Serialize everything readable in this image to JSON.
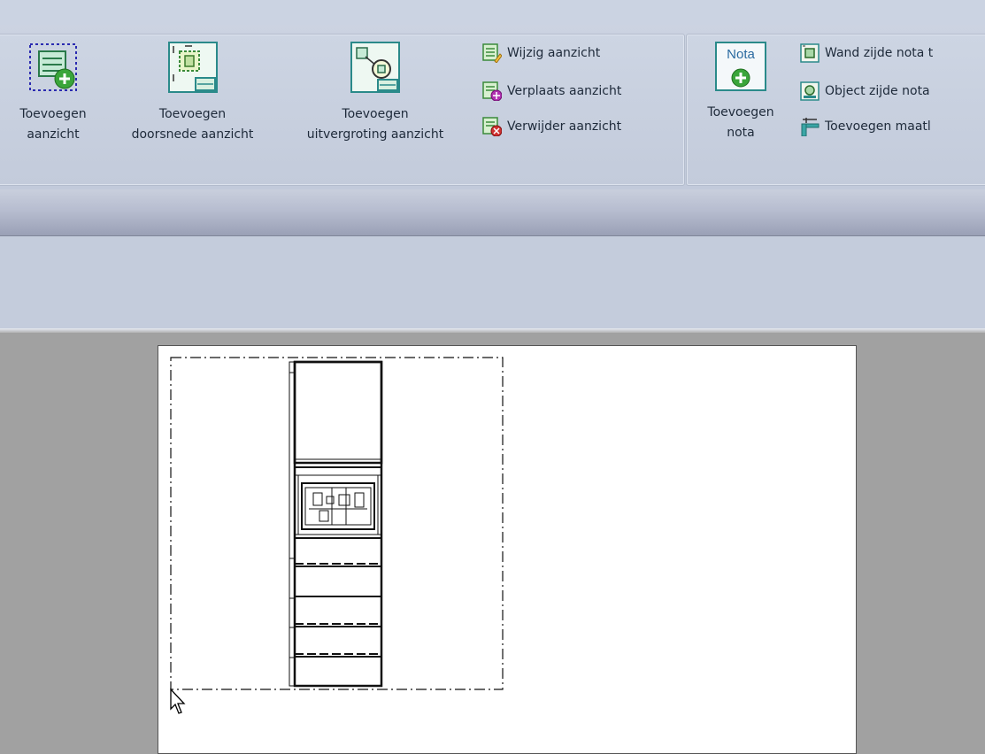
{
  "ribbon": {
    "buttons": {
      "add_view": {
        "line1": "Toevoegen",
        "line2": "aanzicht",
        "icon": "add-view-icon"
      },
      "add_section_view": {
        "line1": "Toevoegen",
        "line2": "doorsnede aanzicht",
        "icon": "section-view-icon"
      },
      "add_detail_view": {
        "line1": "Toevoegen",
        "line2": "uitvergroting aanzicht",
        "icon": "detail-view-icon"
      },
      "edit_view": {
        "label": "Wijzig aanzicht",
        "icon": "edit-view-icon"
      },
      "move_view": {
        "label": "Verplaats aanzicht",
        "icon": "move-view-icon"
      },
      "delete_view": {
        "label": "Verwijder aanzicht",
        "icon": "delete-view-icon"
      },
      "add_note": {
        "icon_text": "Nota",
        "line1": "Toevoegen",
        "line2": "nota",
        "icon": "note-icon"
      },
      "wall_side_note": {
        "label": "Wand zijde nota t",
        "icon": "wall-note-icon"
      },
      "object_side_note": {
        "label": "Object zijde nota",
        "icon": "object-note-icon"
      },
      "add_dimension": {
        "label": "Toevoegen maatl",
        "icon": "dimension-icon"
      }
    }
  },
  "colors": {
    "ribbon": "#c4ccdc",
    "workspace": "#a1a1a1",
    "icon_green": "#3aa53a",
    "icon_teal": "#2a8a8a"
  },
  "canvas": {
    "cursor_icon": "arrow-cursor-icon"
  }
}
